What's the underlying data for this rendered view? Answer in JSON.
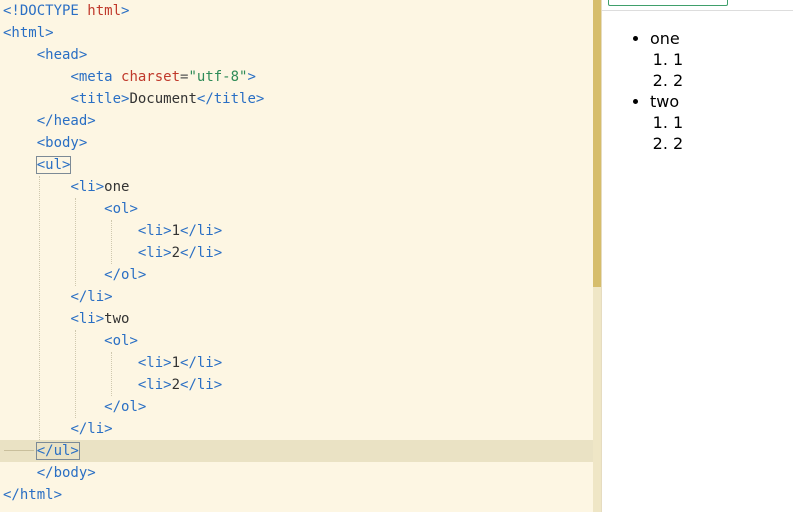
{
  "editor": {
    "lines": [
      [
        {
          "t": "tag",
          "v": "<!DOCTYPE "
        },
        {
          "t": "name",
          "v": "html"
        },
        {
          "t": "tag",
          "v": ">"
        }
      ],
      [
        {
          "t": "tag",
          "v": "<html>"
        }
      ],
      [
        {
          "t": "sp",
          "v": "    "
        },
        {
          "t": "tag",
          "v": "<head>"
        }
      ],
      [
        {
          "t": "sp",
          "v": "        "
        },
        {
          "t": "tag",
          "v": "<meta "
        },
        {
          "t": "attr",
          "v": "charset"
        },
        {
          "t": "op",
          "v": "="
        },
        {
          "t": "str",
          "v": "\"utf-8\""
        },
        {
          "t": "tag",
          "v": ">"
        }
      ],
      [
        {
          "t": "sp",
          "v": "        "
        },
        {
          "t": "tag",
          "v": "<title>"
        },
        {
          "t": "text",
          "v": "Document"
        },
        {
          "t": "tag",
          "v": "</title>"
        }
      ],
      [
        {
          "t": "sp",
          "v": "    "
        },
        {
          "t": "tag",
          "v": "</head>"
        }
      ],
      [
        {
          "t": "sp",
          "v": "    "
        },
        {
          "t": "tag",
          "v": "<body>"
        }
      ],
      [
        {
          "t": "sp",
          "v": "    "
        },
        {
          "t": "cursor",
          "v": "<ul>"
        }
      ],
      [
        {
          "t": "sp",
          "v": "        "
        },
        {
          "t": "tag",
          "v": "<li>"
        },
        {
          "t": "text",
          "v": "one"
        }
      ],
      [
        {
          "t": "sp",
          "v": "            "
        },
        {
          "t": "tag",
          "v": "<ol>"
        }
      ],
      [
        {
          "t": "sp",
          "v": "                "
        },
        {
          "t": "tag",
          "v": "<li>"
        },
        {
          "t": "text",
          "v": "1"
        },
        {
          "t": "tag",
          "v": "</li>"
        }
      ],
      [
        {
          "t": "sp",
          "v": "                "
        },
        {
          "t": "tag",
          "v": "<li>"
        },
        {
          "t": "text",
          "v": "2"
        },
        {
          "t": "tag",
          "v": "</li>"
        }
      ],
      [
        {
          "t": "sp",
          "v": "            "
        },
        {
          "t": "tag",
          "v": "</ol>"
        }
      ],
      [
        {
          "t": "sp",
          "v": "        "
        },
        {
          "t": "tag",
          "v": "</li>"
        }
      ],
      [
        {
          "t": "sp",
          "v": "        "
        },
        {
          "t": "tag",
          "v": "<li>"
        },
        {
          "t": "text",
          "v": "two"
        }
      ],
      [
        {
          "t": "sp",
          "v": "            "
        },
        {
          "t": "tag",
          "v": "<ol>"
        }
      ],
      [
        {
          "t": "sp",
          "v": "                "
        },
        {
          "t": "tag",
          "v": "<li>"
        },
        {
          "t": "text",
          "v": "1"
        },
        {
          "t": "tag",
          "v": "</li>"
        }
      ],
      [
        {
          "t": "sp",
          "v": "                "
        },
        {
          "t": "tag",
          "v": "<li>"
        },
        {
          "t": "text",
          "v": "2"
        },
        {
          "t": "tag",
          "v": "</li>"
        }
      ],
      [
        {
          "t": "sp",
          "v": "            "
        },
        {
          "t": "tag",
          "v": "</ol>"
        }
      ],
      [
        {
          "t": "sp",
          "v": "        "
        },
        {
          "t": "tag",
          "v": "</li>"
        }
      ],
      [
        {
          "t": "sp",
          "v": "    "
        },
        {
          "t": "cursor",
          "v": "</ul>"
        }
      ],
      [
        {
          "t": "sp",
          "v": "    "
        },
        {
          "t": "tag",
          "v": "</body>"
        }
      ],
      [
        {
          "t": "tag",
          "v": "</html>"
        }
      ]
    ],
    "active_line": 20,
    "colors": {
      "background": "#fdf6e3",
      "tag": "#2a6fc4",
      "name": "#c0392b",
      "attr": "#c0392b",
      "string": "#2e8b57",
      "text": "#333333",
      "active_line": "#eae2c4"
    }
  },
  "preview": {
    "items": [
      {
        "label": "one",
        "children": [
          "1",
          "2"
        ]
      },
      {
        "label": "two",
        "children": [
          "1",
          "2"
        ]
      }
    ]
  }
}
